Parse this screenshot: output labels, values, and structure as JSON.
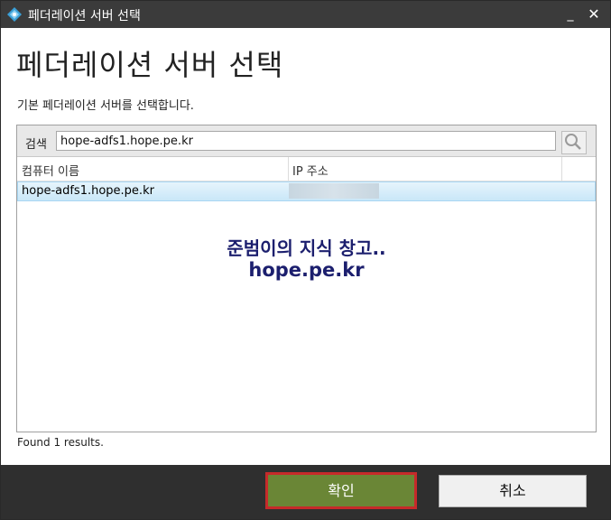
{
  "window": {
    "title": "페더레이션 서버 선택",
    "minimize_glyph": "_",
    "close_glyph": "✕",
    "icon": "adfs-app-icon"
  },
  "page": {
    "heading": "페더레이션 서버 선택",
    "subtitle": "기본 페더레이션 서버를 선택합니다."
  },
  "search": {
    "label": "검색",
    "value": "hope-adfs1.hope.pe.kr",
    "button_icon": "search-icon"
  },
  "table": {
    "columns": [
      "컴퓨터 이름",
      "IP 주소"
    ],
    "rows": [
      {
        "name": "hope-adfs1.hope.pe.kr",
        "ip": ""
      }
    ]
  },
  "watermark": {
    "line1": "준범이의 지식 창고..",
    "line2": "hope.pe.kr"
  },
  "status": {
    "found": "Found 1 results."
  },
  "buttons": {
    "ok": "확인",
    "cancel": "취소"
  },
  "colors": {
    "titlebar": "#3b3b3b",
    "ok_button": "#6a8636",
    "ok_highlight_border": "#c62a2a",
    "selected_row": "#c9e7f8",
    "footer": "#2f2f2f"
  }
}
